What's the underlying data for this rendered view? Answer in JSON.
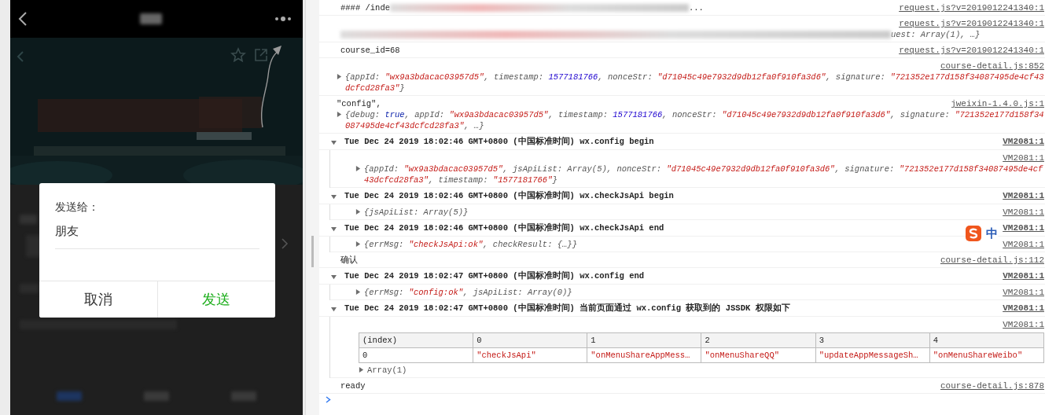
{
  "phone": {
    "dialog": {
      "title": "发送给：",
      "recipient": "朋友",
      "buttons": [
        {
          "label": "取消",
          "kind": "cancel"
        },
        {
          "label": "发送",
          "kind": "confirm"
        }
      ]
    }
  },
  "console": {
    "messages": [
      {
        "kind": "log",
        "source": "request.js?v=2019012241340:1",
        "segments": [
          {
            "kind": "text",
            "text": "#### /inde"
          },
          {
            "kind": "blurred"
          },
          {
            "kind": "text",
            "text": "..."
          }
        ]
      },
      {
        "kind": "log",
        "source": "request.js?v=2019012241340:1",
        "object": {
          "segments": [
            {
              "kind": "blurred"
            },
            {
              "kind": "preview",
              "text": "uest: Array(1), …}"
            }
          ]
        }
      },
      {
        "kind": "log",
        "source": "request.js?v=2019012241340:1",
        "segments": [
          {
            "kind": "text",
            "text": "course_id=68"
          }
        ]
      },
      {
        "kind": "log",
        "source": "course-detail.js:852",
        "object": {
          "expanded": false,
          "segments": [
            {
              "kind": "preview",
              "text": "{appId: "
            },
            {
              "kind": "string",
              "text": "\"wx9a3bdacac03957d5\""
            },
            {
              "kind": "preview",
              "text": ", timestamp: "
            },
            {
              "kind": "number",
              "text": "1577181766"
            },
            {
              "kind": "preview",
              "text": ", nonceStr: "
            },
            {
              "kind": "string",
              "text": "\"d71045c49e7932d9db12fa0f910fa3d6\""
            },
            {
              "kind": "preview",
              "text": ", signature: "
            },
            {
              "kind": "string",
              "text": "\"721352e177d158f34087495de4cf43dcfcd28fa3\""
            },
            {
              "kind": "preview",
              "text": "}"
            }
          ]
        }
      },
      {
        "kind": "log",
        "source": "jweixin-1.4.0.js:1",
        "segments": [
          {
            "kind": "text",
            "text": "\"config\","
          }
        ],
        "object": {
          "expanded": false,
          "segments": [
            {
              "kind": "preview",
              "text": "{debug: "
            },
            {
              "kind": "keyword",
              "text": "true"
            },
            {
              "kind": "preview",
              "text": ", appId: "
            },
            {
              "kind": "string",
              "text": "\"wx9a3bdacac03957d5\""
            },
            {
              "kind": "preview",
              "text": ", timestamp: "
            },
            {
              "kind": "number",
              "text": "1577181766"
            },
            {
              "kind": "preview",
              "text": ", nonceStr: "
            },
            {
              "kind": "string",
              "text": "\"d71045c49e7932d9db12fa0f910fa3d6\""
            },
            {
              "kind": "preview",
              "text": ", signature: "
            },
            {
              "kind": "string",
              "text": "\"721352e177d158f34087495de4cf43dcfcd28fa3\""
            },
            {
              "kind": "preview",
              "text": ", …}"
            }
          ]
        }
      },
      {
        "kind": "group",
        "expanded": true,
        "header": "Tue Dec 24 2019 18:02:46 GMT+0800 (中国标准时间) wx.config begin",
        "source": "VM2081:1",
        "children": [
          {
            "kind": "log",
            "source": "VM2081:1",
            "object": {
              "expanded": false,
              "segments": [
                {
                  "kind": "preview",
                  "text": "{appId: "
                },
                {
                  "kind": "string",
                  "text": "\"wx9a3bdacac03957d5\""
                },
                {
                  "kind": "preview",
                  "text": ", jsApiList: Array(5), nonceStr: "
                },
                {
                  "kind": "string",
                  "text": "\"d71045c49e7932d9db12fa0f910fa3d6\""
                },
                {
                  "kind": "preview",
                  "text": ", signature: "
                },
                {
                  "kind": "string",
                  "text": "\"721352e177d158f34087495de4cf43dcfcd28fa3\""
                },
                {
                  "kind": "preview",
                  "text": ", timestamp: "
                },
                {
                  "kind": "string",
                  "text": "\"1577181766\""
                },
                {
                  "kind": "preview",
                  "text": "}"
                }
              ]
            }
          }
        ]
      },
      {
        "kind": "group",
        "expanded": true,
        "header": "Tue Dec 24 2019 18:02:46 GMT+0800 (中国标准时间) wx.checkJsApi begin",
        "source": "VM2081:1",
        "children": [
          {
            "kind": "log",
            "source": "VM2081:1",
            "object": {
              "expanded": false,
              "segments": [
                {
                  "kind": "preview",
                  "text": "{jsApiList: Array(5)}"
                }
              ]
            }
          }
        ]
      },
      {
        "kind": "group",
        "expanded": true,
        "header": "Tue Dec 24 2019 18:02:46 GMT+0800 (中国标准时间) wx.checkJsApi end",
        "source": "VM2081:1",
        "children": [
          {
            "kind": "log",
            "source": "VM2081:1",
            "object": {
              "expanded": false,
              "segments": [
                {
                  "kind": "preview",
                  "text": "{errMsg: "
                },
                {
                  "kind": "string",
                  "text": "\"checkJsApi:ok\""
                },
                {
                  "kind": "preview",
                  "text": ", checkResult: {…}}"
                }
              ]
            }
          }
        ]
      },
      {
        "kind": "log",
        "source": "course-detail.js:112",
        "segments": [
          {
            "kind": "text",
            "text": "确认"
          }
        ]
      },
      {
        "kind": "group",
        "expanded": true,
        "header": "Tue Dec 24 2019 18:02:47 GMT+0800 (中国标准时间) wx.config end",
        "source": "VM2081:1",
        "children": [
          {
            "kind": "log",
            "source": "VM2081:1",
            "object": {
              "expanded": false,
              "segments": [
                {
                  "kind": "preview",
                  "text": "{errMsg: "
                },
                {
                  "kind": "string",
                  "text": "\"config:ok\""
                },
                {
                  "kind": "preview",
                  "text": ", jsApiList: Array(0)}"
                }
              ]
            }
          }
        ]
      },
      {
        "kind": "group",
        "expanded": true,
        "header": "Tue Dec 24 2019 18:02:47 GMT+0800 (中国标准时间) 当前页面通过 wx.config 获取到的 JSSDK 权限如下",
        "source": "VM2081:1",
        "children": [
          {
            "kind": "table",
            "source": "VM2081:1",
            "columns": [
              "(index)",
              "0",
              "1",
              "2",
              "3",
              "4"
            ],
            "rows": [
              [
                "0",
                "\"checkJsApi\"",
                "\"onMenuShareAppMess…",
                "\"onMenuShareQQ\"",
                "\"updateAppMessageSh…",
                "\"onMenuShareWeibo\""
              ]
            ],
            "footer": {
              "expanded": false,
              "text": "Array(1)"
            }
          }
        ]
      },
      {
        "kind": "log",
        "source": "course-detail.js:878",
        "segments": [
          {
            "kind": "text",
            "text": "ready"
          }
        ]
      }
    ]
  },
  "ime_indicator": {
    "label": "中"
  },
  "bottom_tabs": [
    {
      "selected": true
    },
    {
      "selected": false
    },
    {
      "selected": false
    }
  ]
}
